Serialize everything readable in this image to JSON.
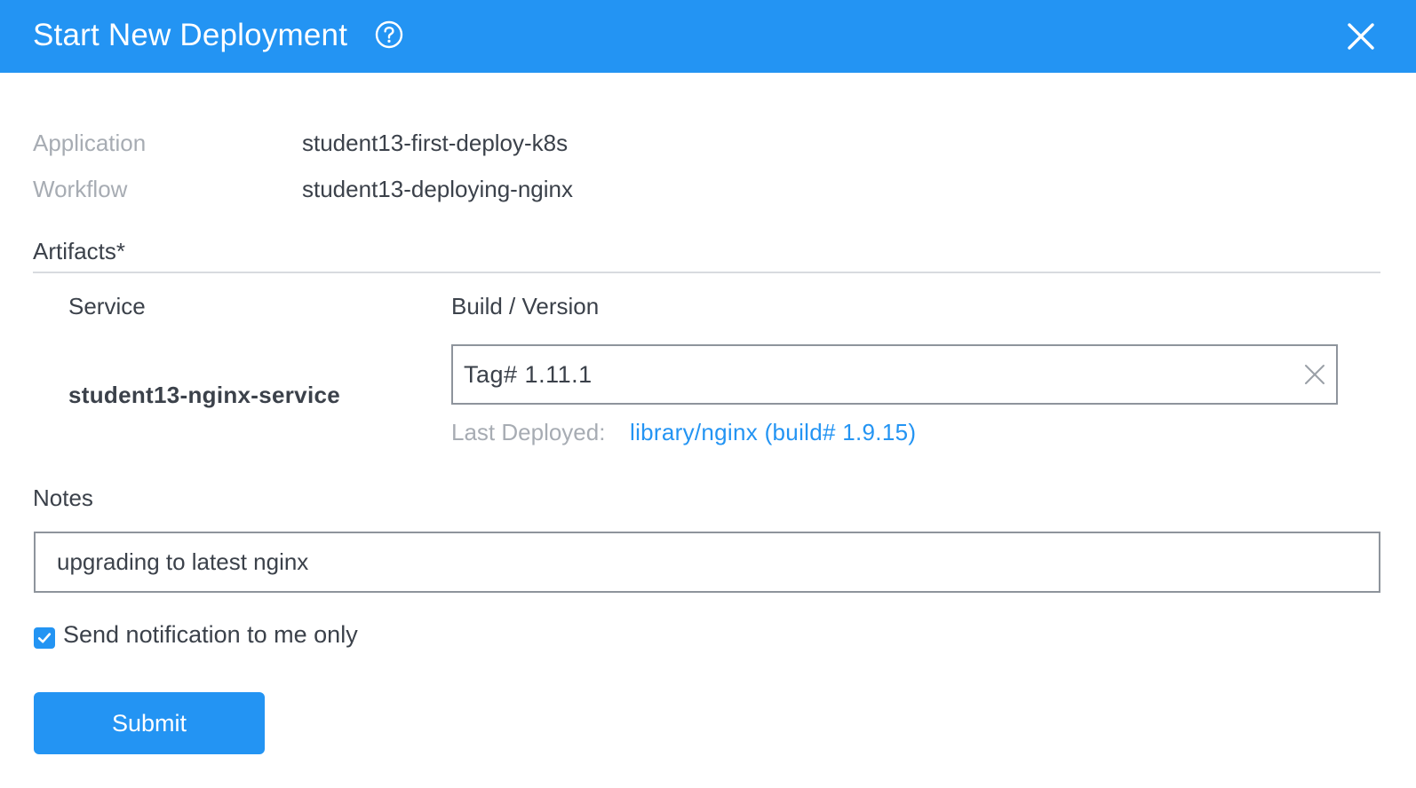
{
  "dialog": {
    "title": "Start New Deployment",
    "accent_color": "#2394f3",
    "icons": {
      "help": "help-circle-icon",
      "close": "close-icon"
    }
  },
  "meta": {
    "application_label": "Application",
    "application_value": "student13-first-deploy-k8s",
    "workflow_label": "Workflow",
    "workflow_value": "student13-deploying-nginx"
  },
  "artifacts": {
    "section_title": "Artifacts*",
    "service_header": "Service",
    "build_header": "Build / Version",
    "rows": [
      {
        "service": "student13-nginx-service",
        "selected_build": "Tag# 1.11.1",
        "last_deployed_label": "Last Deployed:",
        "last_deployed_link": "library/nginx (build# 1.9.15)"
      }
    ]
  },
  "notes": {
    "label": "Notes",
    "value": "upgrading to latest nginx"
  },
  "notification": {
    "label": "Send notification to me only",
    "checked": true
  },
  "actions": {
    "submit_label": "Submit"
  }
}
